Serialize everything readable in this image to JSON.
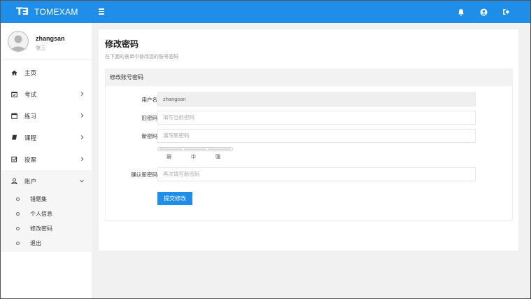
{
  "app": {
    "logo_mark": "T∃",
    "name": "TOMEXAM"
  },
  "topbar": {
    "icons": [
      "bell-icon",
      "user-circle-icon",
      "sign-out-icon"
    ]
  },
  "user": {
    "name": "zhangsan",
    "role": "张三"
  },
  "sidebar": {
    "items": [
      {
        "label": "主页",
        "icon": "home-icon",
        "has_children": false
      },
      {
        "label": "考试",
        "icon": "calendar-check-icon",
        "has_children": true
      },
      {
        "label": "练习",
        "icon": "calendar-icon",
        "has_children": true
      },
      {
        "label": "课程",
        "icon": "book-icon",
        "has_children": true
      },
      {
        "label": "投票",
        "icon": "check-square-icon",
        "has_children": true
      },
      {
        "label": "账户",
        "icon": "user-icon",
        "has_children": true,
        "expanded": true
      }
    ],
    "account_sub": [
      "错题集",
      "个人信息",
      "修改密码",
      "退出"
    ]
  },
  "page": {
    "title": "修改密码",
    "subtitle": "在下面的表单中修改您的账号密码",
    "panel_title": "修改账号密码"
  },
  "form": {
    "username_label": "用户名",
    "username_value": "zhangsan",
    "old_label": "旧密码",
    "old_placeholder": "填写当前密码",
    "new_label": "新密码",
    "new_placeholder": "填写新密码",
    "strength": [
      "弱",
      "中",
      "强"
    ],
    "confirm_label": "确认新密码",
    "confirm_placeholder": "再次填写新密码",
    "submit_label": "提交修改"
  },
  "colors": {
    "primary": "#1e8ee8",
    "background": "#f1f1f1"
  }
}
